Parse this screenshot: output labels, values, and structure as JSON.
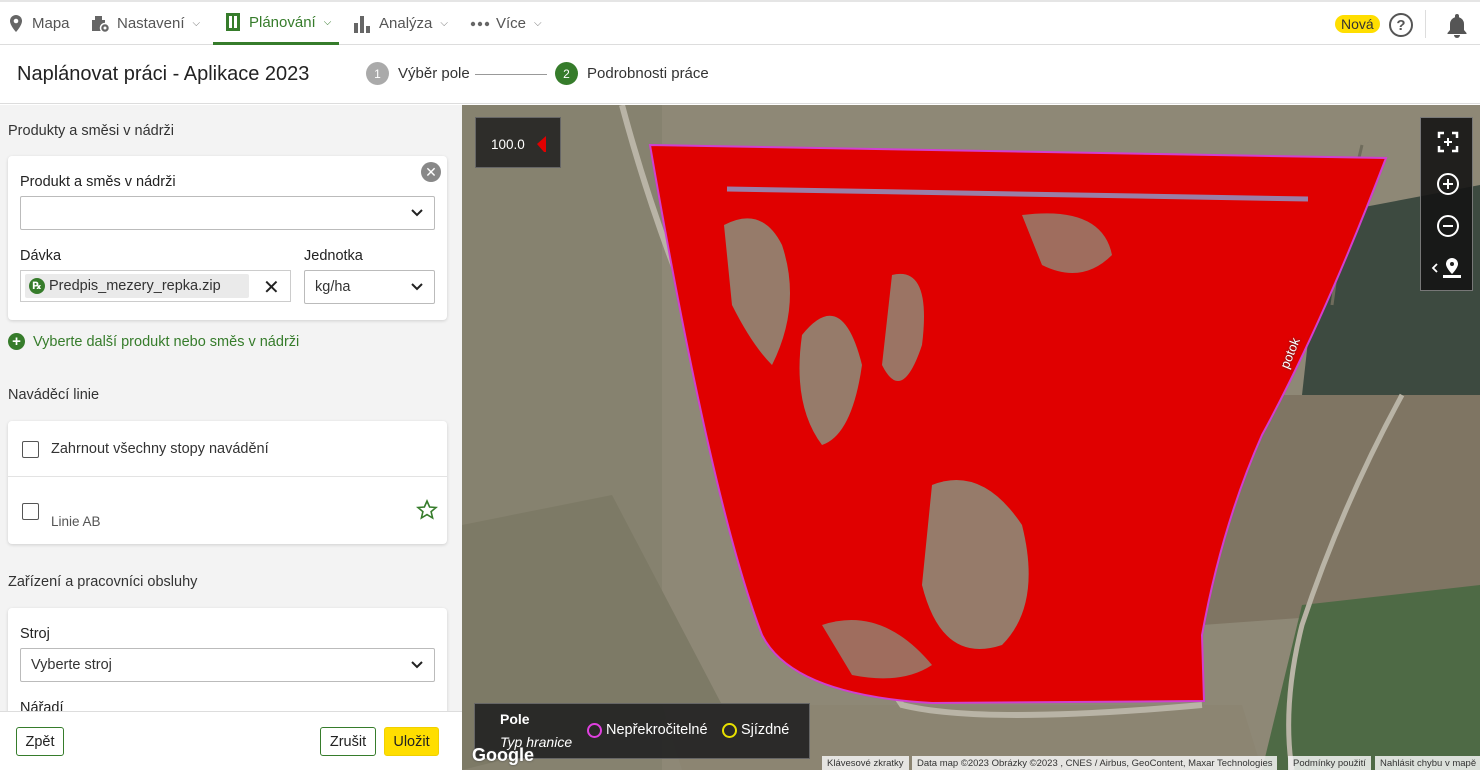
{
  "nav": {
    "items": [
      {
        "label": "Mapa",
        "icon": "map-pin-icon"
      },
      {
        "label": "Nastavení",
        "icon": "settings-gear-icon"
      },
      {
        "label": "Plánování",
        "icon": "planning-clipboard-icon",
        "active": true
      },
      {
        "label": "Analýza",
        "icon": "bar-chart-icon"
      },
      {
        "label": "Více",
        "icon": "more-dots-icon"
      }
    ],
    "badge": "Nová",
    "help": "?"
  },
  "header": {
    "title": "Naplánovat práci - Aplikace 2023",
    "steps": [
      {
        "num": "1",
        "label": "Výběr pole",
        "state": "done"
      },
      {
        "num": "2",
        "label": "Podrobnosti práce",
        "state": "active"
      }
    ]
  },
  "products": {
    "section_title": "Produkty a směsi v nádrži",
    "product_label": "Produkt a směs v nádrži",
    "product_value": "",
    "dose_label": "Dávka",
    "dose_file": "Predpis_mezery_repka.zip",
    "unit_label": "Jednotka",
    "unit_value": "kg/ha",
    "add_link": "Vyberte další produkt nebo směs v nádrži"
  },
  "guidance": {
    "section_title": "Naváděcí linie",
    "include_all": "Zahrnout všechny stopy navádění",
    "ab_line": "Linie AB"
  },
  "equipment": {
    "section_title": "Zařízení a pracovníci obsluhy",
    "machine_label": "Stroj",
    "machine_placeholder": "Vyberte stroj",
    "tool_label": "Nářadí"
  },
  "footer": {
    "back": "Zpět",
    "cancel": "Zrušit",
    "save": "Uložit"
  },
  "map": {
    "scale_value": "100.0",
    "river_label": "potok",
    "legend": {
      "title": "Pole",
      "subtitle": "Typ hranice",
      "items": [
        {
          "label": "Nepřekročitelné",
          "color": "#e040e0"
        },
        {
          "label": "Sjízdné",
          "color": "#e8e000"
        }
      ]
    },
    "google": "Google",
    "attributions": [
      "Klávesové zkratky",
      "Data map ©2023 Obrázky ©2023 , CNES / Airbus, GeoContent, Maxar Technologies",
      "Podmínky použití",
      "Nahlásit chybu v mapě"
    ],
    "colors": {
      "prescription": "#e00000",
      "boundary": "#d040d0",
      "accent": "#367c2b"
    }
  }
}
